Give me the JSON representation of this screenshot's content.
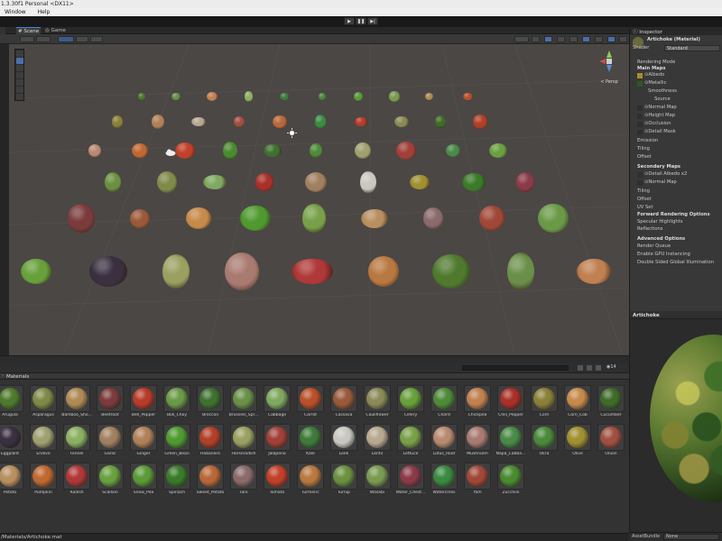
{
  "window": {
    "title": "1.3.30f1 Personal <DX11>"
  },
  "menu": {
    "items": [
      "Window",
      "Help"
    ]
  },
  "play": {
    "play_icon": "play-icon",
    "pause_icon": "pause-icon",
    "step_icon": "step-icon"
  },
  "scene_tabs": {
    "scene": "Scene",
    "game": "Game"
  },
  "viewport": {
    "persp_label": "< Persp",
    "background": "#4b4745"
  },
  "project": {
    "title": "Materials",
    "count_label": "14",
    "materials": [
      {
        "name": "Arugula",
        "color": "#4f7a2e"
      },
      {
        "name": "Asparagus",
        "color": "#7f8a48"
      },
      {
        "name": "Bamboo_Sho...",
        "color": "#b08a56"
      },
      {
        "name": "Beetroot",
        "color": "#7a3b3b"
      },
      {
        "name": "Bell_Pepper",
        "color": "#b83b2a"
      },
      {
        "name": "Bok_Choy",
        "color": "#6a9a48"
      },
      {
        "name": "Broccoli",
        "color": "#3f7030"
      },
      {
        "name": "Brussels_Spr...",
        "color": "#6a8f48"
      },
      {
        "name": "Cabbage",
        "color": "#7fa860"
      },
      {
        "name": "Carrot",
        "color": "#b8502a"
      },
      {
        "name": "Cassava",
        "color": "#9a5a3a"
      },
      {
        "name": "Cauliflower",
        "color": "#8a8a58"
      },
      {
        "name": "Celery",
        "color": "#68a03a"
      },
      {
        "name": "Chard",
        "color": "#4f8a3a"
      },
      {
        "name": "Chickpea",
        "color": "#c08050"
      },
      {
        "name": "Chili_Pepper",
        "color": "#a83028"
      },
      {
        "name": "Corn",
        "color": "#8a8038"
      },
      {
        "name": "Corn_Cob",
        "color": "#c68a4a"
      },
      {
        "name": "Cucumber",
        "color": "#3f6a2a"
      },
      {
        "name": "Eggplant",
        "color": "#3a3040"
      },
      {
        "name": "Endive",
        "color": "#a0a070"
      },
      {
        "name": "Fennel",
        "color": "#8ab060"
      },
      {
        "name": "Garlic",
        "color": "#a08060"
      },
      {
        "name": "Ginger",
        "color": "#b08058"
      },
      {
        "name": "Green_Bean",
        "color": "#4f9a30"
      },
      {
        "name": "Habanero",
        "color": "#b04028"
      },
      {
        "name": "Horseradish",
        "color": "#9aa060"
      },
      {
        "name": "Jalapeno",
        "color": "#a04038"
      },
      {
        "name": "Kale",
        "color": "#3f7a3a"
      },
      {
        "name": "Leek",
        "color": "#c8c8c0"
      },
      {
        "name": "Lentil",
        "color": "#b8a890"
      },
      {
        "name": "Lettuce",
        "color": "#78a048"
      },
      {
        "name": "Lotus_Root",
        "color": "#b88a70"
      },
      {
        "name": "Mushroom",
        "color": "#a87a70"
      },
      {
        "name": "Napa_Cabba...",
        "color": "#4a8a48"
      },
      {
        "name": "Okra",
        "color": "#4a8a3a"
      },
      {
        "name": "Olive",
        "color": "#a09030"
      },
      {
        "name": "Onion",
        "color": "#a05040"
      },
      {
        "name": "Potato",
        "color": "#b89060"
      },
      {
        "name": "Pumpkin",
        "color": "#c06830"
      },
      {
        "name": "Radish",
        "color": "#b03838"
      },
      {
        "name": "Scallion",
        "color": "#6aa040"
      },
      {
        "name": "Snow_Pea",
        "color": "#5a9a38"
      },
      {
        "name": "Spinach",
        "color": "#3a7a28"
      },
      {
        "name": "Sweet_Potato",
        "color": "#b86838"
      },
      {
        "name": "Taro",
        "color": "#8a6a6a"
      },
      {
        "name": "Tomato",
        "color": "#c04028"
      },
      {
        "name": "Turmeric",
        "color": "#b87840"
      },
      {
        "name": "Turnip",
        "color": "#6a9040"
      },
      {
        "name": "Wasabi",
        "color": "#7a9a50"
      },
      {
        "name": "Water_Chest...",
        "color": "#8a3a48"
      },
      {
        "name": "Watercress",
        "color": "#3a8a40"
      },
      {
        "name": "Yam",
        "color": "#a04838"
      },
      {
        "name": "Zucchini",
        "color": "#4a8a30"
      }
    ]
  },
  "status": {
    "path": "/Materials/Artichoke.mat"
  },
  "inspector": {
    "tab": "Inspector",
    "object_name": "Artichoke (Material)",
    "shader_label": "Shader",
    "shader_value": "Standard",
    "rendering_mode": "Rendering Mode",
    "main_maps": "Main Maps",
    "albedo": "Albedo",
    "metallic": "Metallic",
    "smoothness": "Smoothness",
    "source": "Source",
    "normal_map": "Normal Map",
    "height_map": "Height Map",
    "occlusion": "Occlusion",
    "detail_mask": "Detail Mask",
    "emission": "Emission",
    "tiling": "Tiling",
    "offset": "Offset",
    "secondary_maps": "Secondary Maps",
    "detail_albedo": "Detail Albedo x2",
    "normal_map2": "Normal Map",
    "tiling2": "Tiling",
    "offset2": "Offset",
    "uv_set": "UV Set",
    "forward_options": "Forward Rendering Options",
    "specular": "Specular Highlights",
    "reflections": "Reflections",
    "advanced": "Advanced Options",
    "render_queue": "Render Queue",
    "gpu_instancing": "Enable GPU Instancing",
    "double_sided": "Double Sided Global Illumination",
    "albedo_color": "#b08a2a",
    "metallic_color": "#2a5a22"
  },
  "preview": {
    "title": "Artichoke"
  },
  "assetbundle": {
    "label": "AssetBundle",
    "value": "None"
  }
}
